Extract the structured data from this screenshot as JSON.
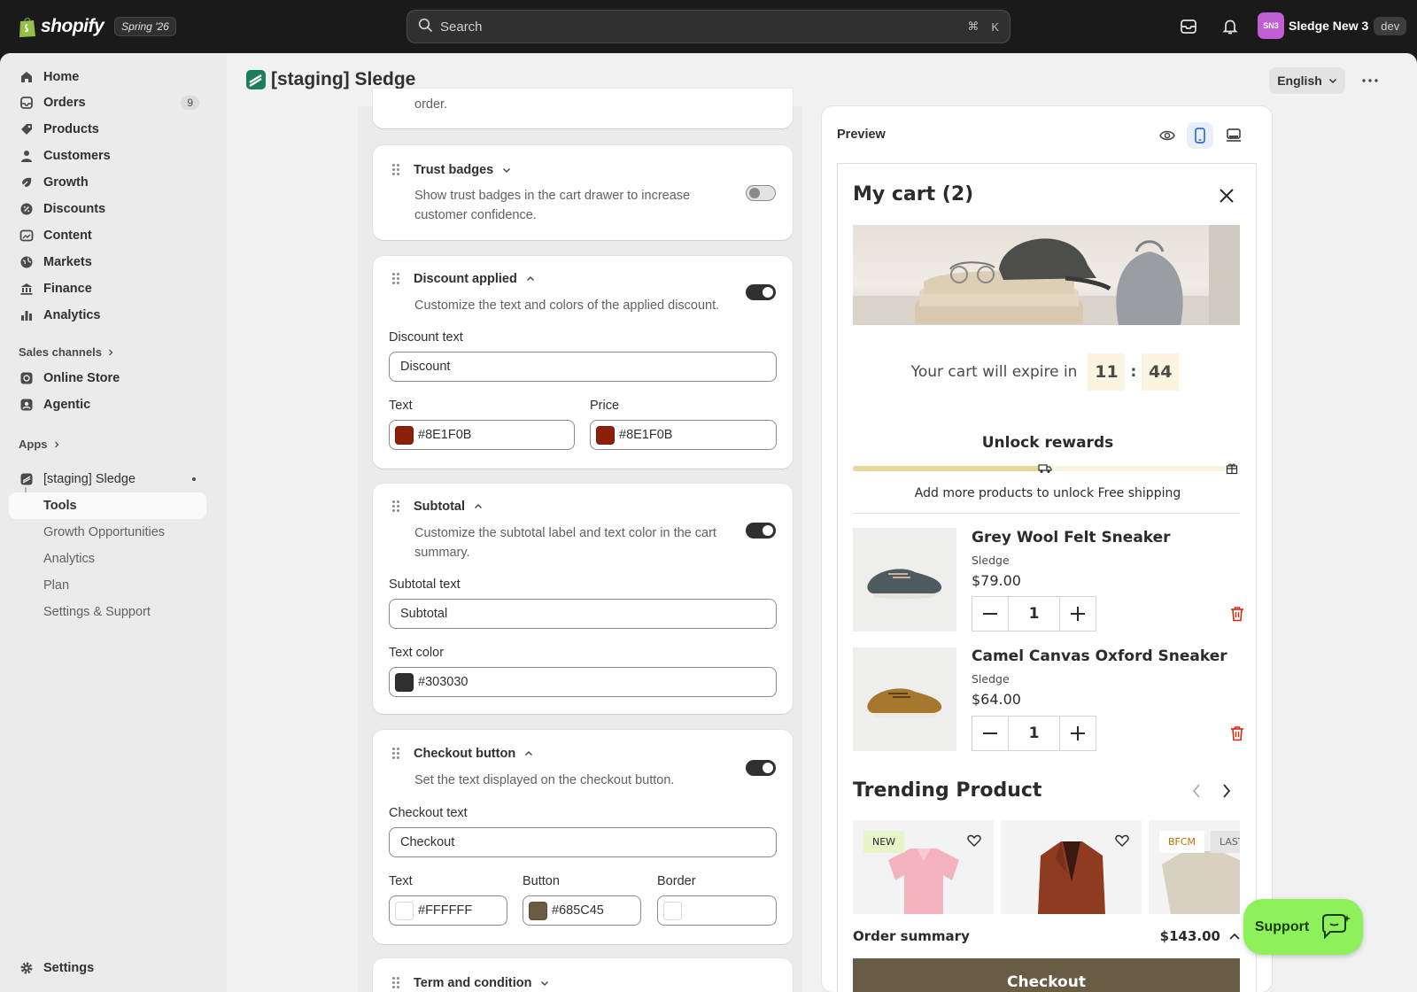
{
  "topbar": {
    "brand": "shopify",
    "release": "Spring '26",
    "search_placeholder": "Search",
    "shortcut_cmd": "⌘",
    "shortcut_key": "K",
    "avatar_initials": "SN3",
    "store_name": "Sledge New 3",
    "env_badge": "dev"
  },
  "sidebar": {
    "items": [
      {
        "label": "Home",
        "icon": "home-icon"
      },
      {
        "label": "Orders",
        "icon": "orders-icon",
        "count": "9"
      },
      {
        "label": "Products",
        "icon": "tag-icon"
      },
      {
        "label": "Customers",
        "icon": "person-icon"
      },
      {
        "label": "Growth",
        "icon": "growth-icon"
      },
      {
        "label": "Discounts",
        "icon": "discount-icon"
      },
      {
        "label": "Content",
        "icon": "content-icon"
      },
      {
        "label": "Markets",
        "icon": "globe-icon"
      },
      {
        "label": "Finance",
        "icon": "bank-icon"
      },
      {
        "label": "Analytics",
        "icon": "bar-chart-icon"
      }
    ],
    "sales_channels_label": "Sales channels",
    "channels": [
      {
        "label": "Online Store",
        "icon": "store-icon"
      },
      {
        "label": "Agentic",
        "icon": "agentic-icon"
      }
    ],
    "apps_label": "Apps",
    "app": {
      "label": "[staging] Sledge"
    },
    "app_sub_items": [
      "Tools",
      "Growth Opportunities",
      "Analytics",
      "Plan",
      "Settings & Support"
    ],
    "settings_label": "Settings"
  },
  "page": {
    "title": "[staging] Sledge",
    "language": "English"
  },
  "cards": {
    "partial_text": "order.",
    "trust": {
      "title": "Trust badges",
      "desc1": "Show trust badges in the cart drawer to increase",
      "desc2": "customer confidence.",
      "enabled": false
    },
    "discount": {
      "title": "Discount applied",
      "desc": "Customize the text and colors of the applied discount.",
      "enabled": true,
      "text_label": "Discount text",
      "text_value": "Discount",
      "color_label": "Text",
      "color_value": "#8E1F0B",
      "price_label": "Price",
      "price_value": "#8E1F0B"
    },
    "subtotal": {
      "title": "Subtotal",
      "desc1": "Customize the subtotal label and text color in the cart",
      "desc2": "summary.",
      "enabled": true,
      "text_label": "Subtotal text",
      "text_value": "Subtotal",
      "color_label": "Text color",
      "color_value": "#303030"
    },
    "checkout": {
      "title": "Checkout button",
      "desc": "Set the text displayed on the checkout button.",
      "enabled": true,
      "text_label": "Checkout text",
      "text_value": "Checkout",
      "text_color_label": "Text",
      "text_color_value": "#FFFFFF",
      "button_label": "Button",
      "button_value": "#685C45",
      "border_label": "Border",
      "border_value": ""
    },
    "terms": {
      "title": "Term and condition"
    }
  },
  "preview": {
    "title": "Preview",
    "cart_title": "My cart (2)",
    "expire_text": "Your cart will expire in",
    "minutes": "11",
    "separator": ":",
    "seconds": "44",
    "unlock_title": "Unlock rewards",
    "progress_fraction": 0.5,
    "unlock_msg": "Add more products to unlock Free shipping",
    "items": [
      {
        "name": "Grey Wool Felt Sneaker",
        "vendor": "Sledge",
        "price": "$79.00",
        "qty": "1"
      },
      {
        "name": "Camel Canvas Oxford Sneaker",
        "vendor": "Sledge",
        "price": "$64.00",
        "qty": "1"
      }
    ],
    "trending_title": "Trending Product",
    "trending_badges": [
      "NEW",
      "BFCM",
      "LAST"
    ],
    "order_summary_label": "Order summary",
    "order_total": "$143.00",
    "checkout_label": "Checkout"
  },
  "support": {
    "label": "Support"
  },
  "colors": {
    "discount_text": "#8E1F0B",
    "subtotal_text": "#303030",
    "checkout_button": "#685C45",
    "support_bg": "#8EF15C",
    "toggle_on": "#303030"
  }
}
